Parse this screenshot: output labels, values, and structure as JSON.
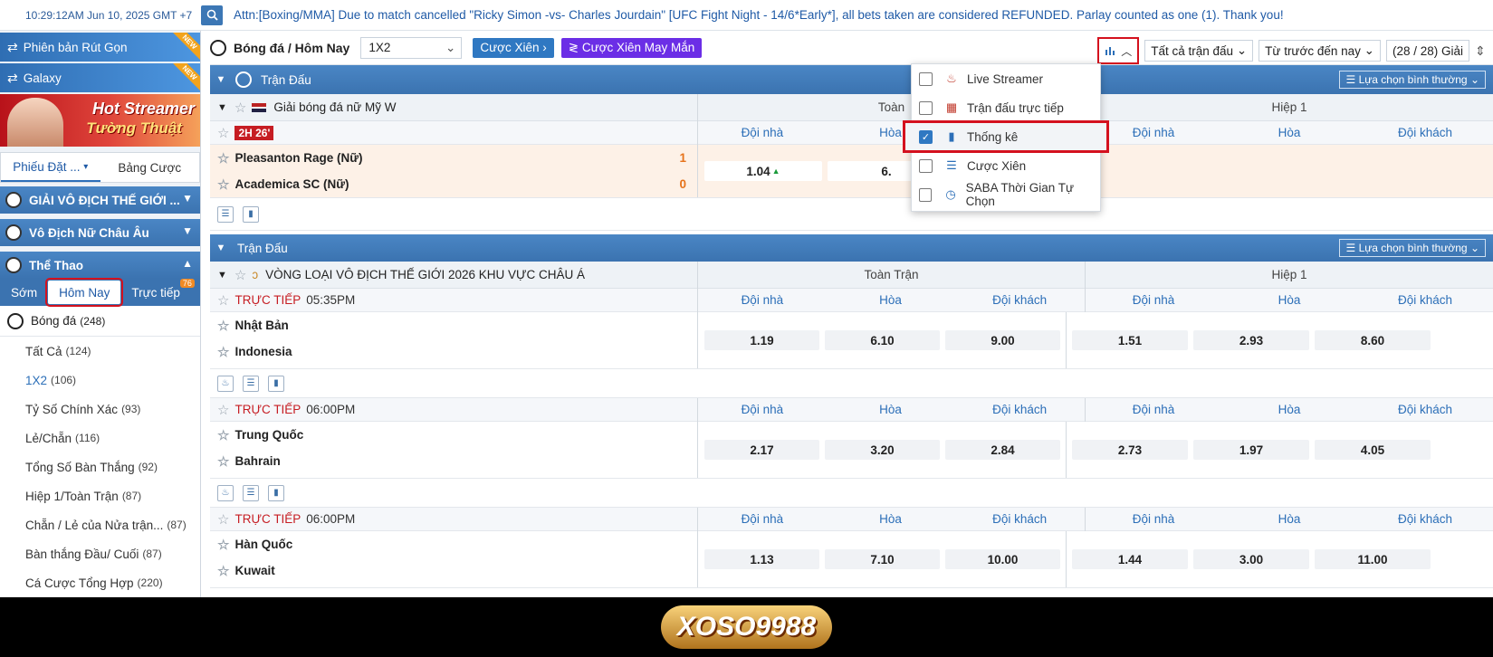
{
  "topbar": {
    "clock": "10:29:12AM Jun 10, 2025 GMT +7",
    "notice": "Attn:[Boxing/MMA] Due to match cancelled \"Ricky Simon -vs- Charles Jourdain\" [UFC Fight Night - 14/6*Early*], all bets taken are considered REFUNDED. Parlay counted as one (1). Thank you!"
  },
  "sidebar": {
    "promo1": "Phiên bản Rút Gọn",
    "promo2": "Galaxy",
    "new_tag": "NEW",
    "banner_line1": "Hot Streamer",
    "banner_line2": "Tường Thuật",
    "tab_ticket": "Phiếu Đặt ...",
    "tab_bets": "Bảng Cược",
    "sec1": "GIẢI VÔ ĐỊCH THẾ GIỚI ...",
    "sec2": "Vô Địch Nữ Châu Âu",
    "sec3": "Thể Thao",
    "time_early": "Sớm",
    "time_today": "Hôm Nay",
    "time_live": "Trực tiếp",
    "live_badge": "76",
    "sport_name": "Bóng đá",
    "sport_count": "(248)",
    "items": [
      {
        "label": "Tất Cả",
        "count": "(124)"
      },
      {
        "label": "1X2",
        "count": "(106)"
      },
      {
        "label": "Tỷ Số Chính Xác",
        "count": "(93)"
      },
      {
        "label": "Lẻ/Chẵn",
        "count": "(116)"
      },
      {
        "label": "Tổng Số Bàn Thắng",
        "count": "(92)"
      },
      {
        "label": "Hiệp 1/Toàn Trận",
        "count": "(87)"
      },
      {
        "label": "Chẵn / Lẻ của Nửa trận...",
        "count": "(87)"
      },
      {
        "label": "Bàn thắng Đầu/ Cuối",
        "count": "(87)"
      },
      {
        "label": "Cá Cược Tổng Hợp",
        "count": "(220)"
      }
    ]
  },
  "toolbar": {
    "title": "Bóng đá / Hôm Nay",
    "market": "1X2",
    "parlay": "Cược Xiên",
    "lucky_parlay": "Cược Xiên May Mắn",
    "filter_all": "Tất cả trận đấu",
    "sort": "Từ trước đến nay",
    "league_count": "(28 / 28) Giải"
  },
  "popup": {
    "items": [
      {
        "label": "Live Streamer",
        "checked": false
      },
      {
        "label": "Trận đấu trực tiếp",
        "checked": false
      },
      {
        "label": "Thống kê",
        "checked": true
      },
      {
        "label": "Cược Xiên",
        "checked": false
      },
      {
        "label": "SABA Thời Gian Tự Chọn",
        "checked": false
      }
    ]
  },
  "section1": {
    "title": "Trận Đấu",
    "select": "Lựa chọn bình thường",
    "league": "Giải bóng đá nữ Mỹ W",
    "fulltime": "Toàn",
    "half": "Hiệp 1",
    "live_time": "2H 26'",
    "home_h": "Đội nhà",
    "draw_h": "Hòa",
    "away_h": "Đội khách",
    "team1": "Pleasanton Rage (Nữ)",
    "team2": "Academica SC (Nữ)",
    "score1": "1",
    "score2": "0",
    "odd1": "1.04",
    "odd2": "6."
  },
  "section2": {
    "title": "Trận Đấu",
    "select": "Lựa chọn bình thường",
    "league": "VÒNG LOẠI VÔ ĐỊCH THẾ GIỚI 2026 KHU VỰC CHÂU Á",
    "fulltime": "Toàn Trận",
    "half": "Hiệp 1",
    "home_h": "Đội nhà",
    "draw_h": "Hòa",
    "away_h": "Đội khách",
    "live_label": "TRỰC TIẾP",
    "matches": [
      {
        "time": "05:35PM",
        "home": "Nhật Bản",
        "away": "Indonesia",
        "odds": [
          "1.19",
          "6.10",
          "9.00",
          "1.51",
          "2.93",
          "8.60"
        ]
      },
      {
        "time": "06:00PM",
        "home": "Trung Quốc",
        "away": "Bahrain",
        "odds": [
          "2.17",
          "3.20",
          "2.84",
          "2.73",
          "1.97",
          "4.05"
        ]
      },
      {
        "time": "06:00PM",
        "home": "Hàn Quốc",
        "away": "Kuwait",
        "odds": [
          "1.13",
          "7.10",
          "10.00",
          "1.44",
          "3.00",
          "11.00"
        ]
      }
    ]
  },
  "footer": {
    "logo": "XOSO9988"
  },
  "colors": {
    "accent": "#3b73b0",
    "highlight": "#d4111e",
    "purple": "#6b2ee6",
    "live": "#c61d23"
  }
}
